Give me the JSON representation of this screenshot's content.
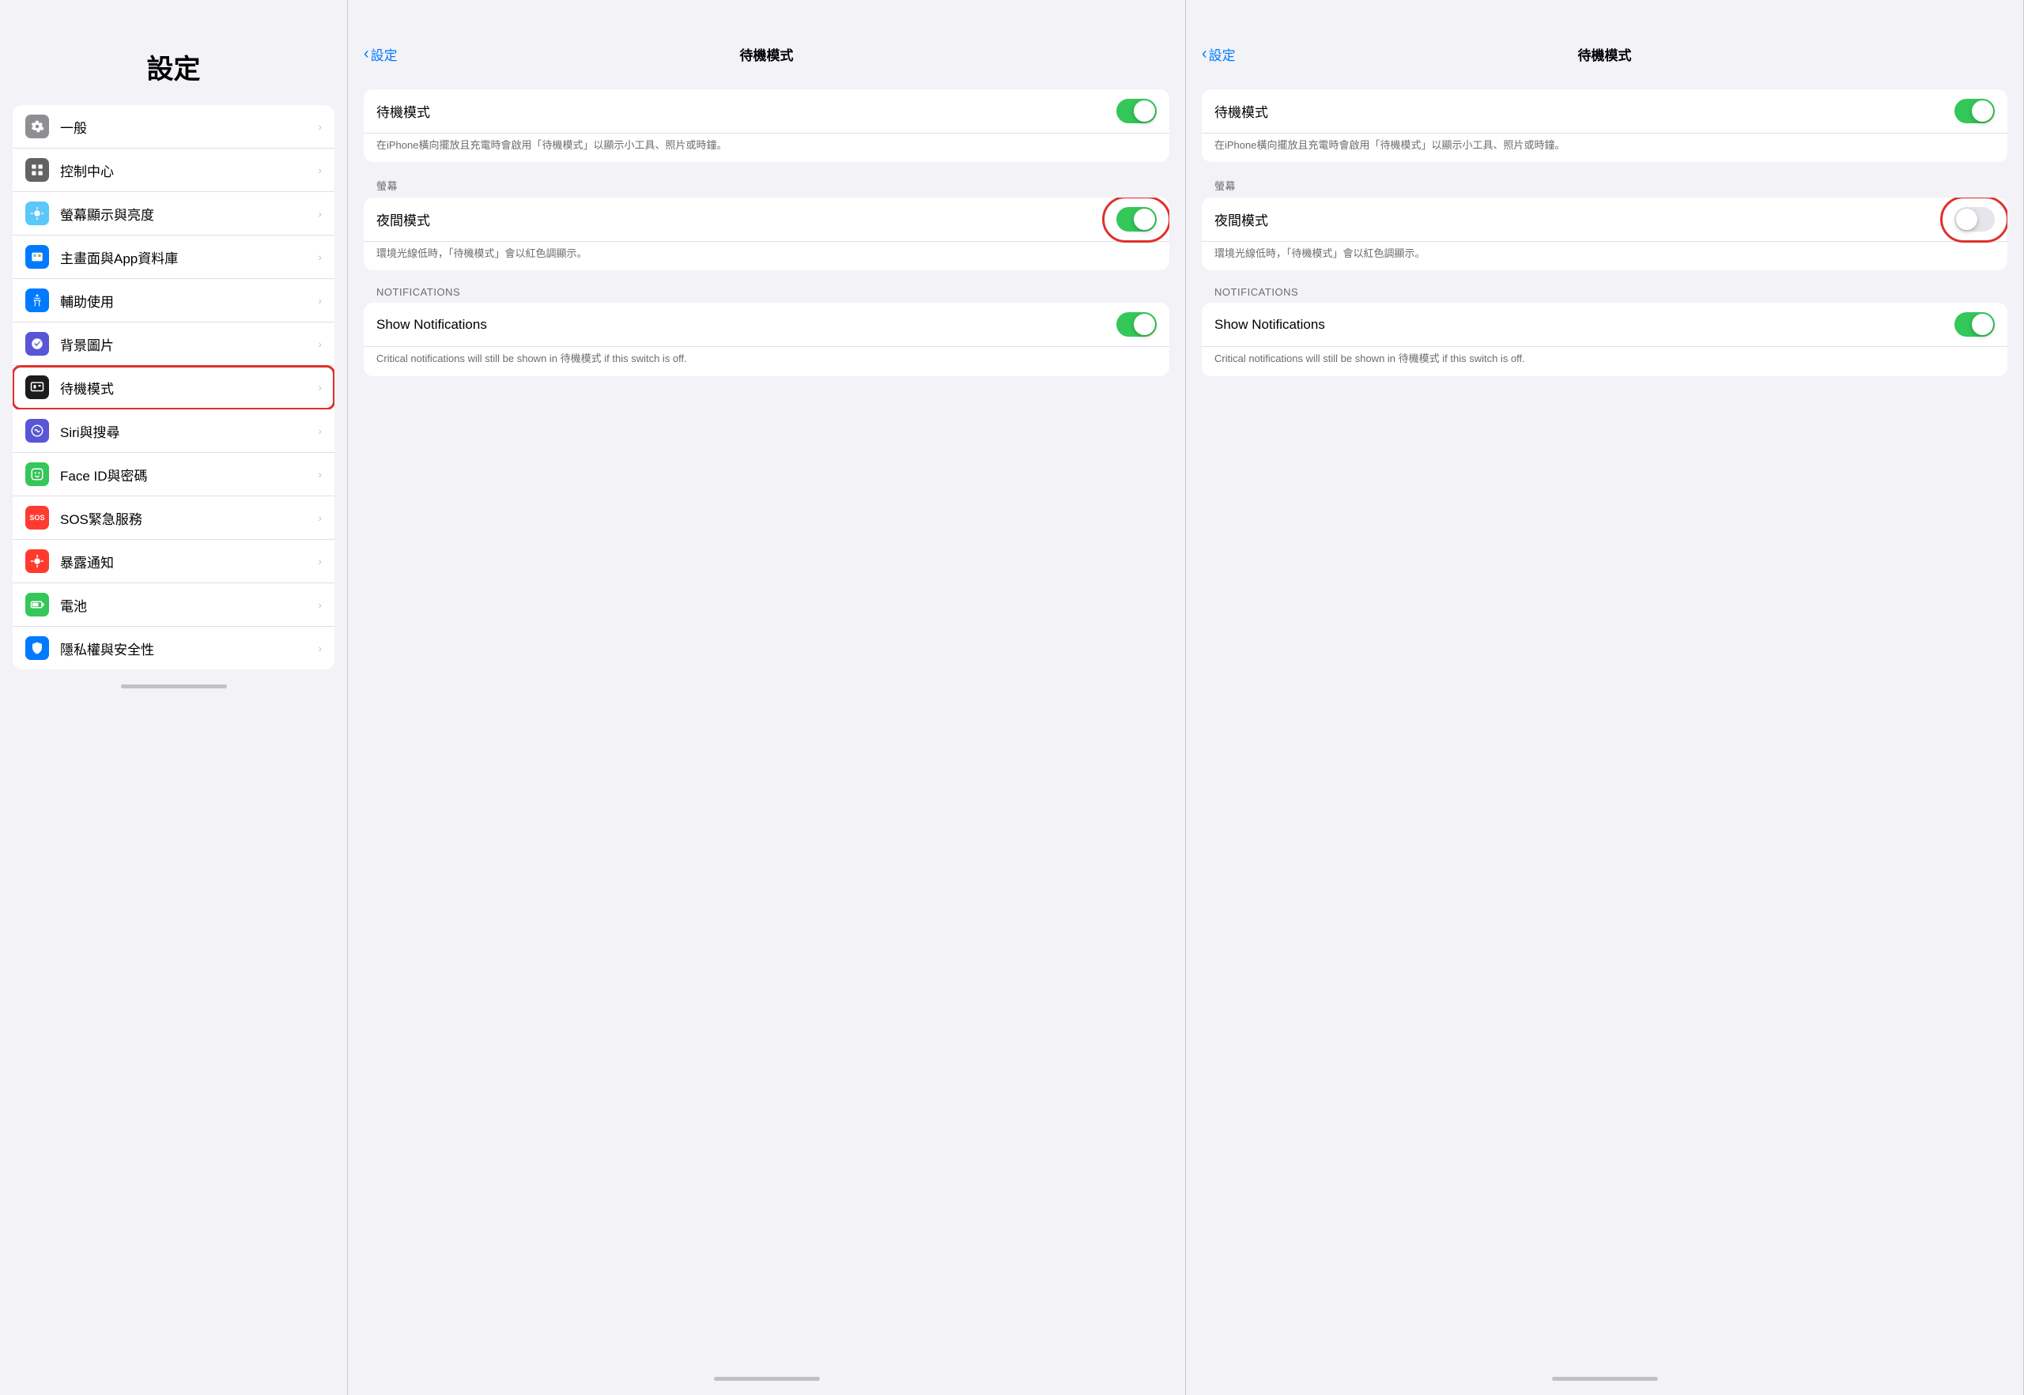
{
  "left": {
    "title": "設定",
    "items": [
      {
        "id": "general",
        "label": "一般",
        "iconClass": "ic-gray",
        "icon": "⚙️"
      },
      {
        "id": "control-center",
        "label": "控制中心",
        "iconClass": "ic-gray2",
        "icon": "🎛"
      },
      {
        "id": "display",
        "label": "螢幕顯示與亮度",
        "iconClass": "ic-blue2",
        "icon": "☀️"
      },
      {
        "id": "homescreen",
        "label": "主畫面與App資料庫",
        "iconClass": "ic-blue",
        "icon": "📱"
      },
      {
        "id": "accessibility",
        "label": "輔助使用",
        "iconClass": "ic-blue",
        "icon": "♿"
      },
      {
        "id": "wallpaper",
        "label": "背景圖片",
        "iconClass": "ic-indigo",
        "icon": "🌸"
      },
      {
        "id": "standby",
        "label": "待機模式",
        "iconClass": "ic-dark",
        "icon": "⊞",
        "highlighted": true
      },
      {
        "id": "siri",
        "label": "Siri與搜尋",
        "iconClass": "ic-indigo",
        "icon": "◉"
      },
      {
        "id": "faceid",
        "label": "Face ID與密碼",
        "iconClass": "ic-green",
        "icon": "😊"
      },
      {
        "id": "sos",
        "label": "SOS緊急服務",
        "iconClass": "ic-sos",
        "icon": "SOS"
      },
      {
        "id": "exposure",
        "label": "暴露通知",
        "iconClass": "ic-red",
        "icon": "☀"
      },
      {
        "id": "battery",
        "label": "電池",
        "iconClass": "ic-green",
        "icon": "🔋"
      },
      {
        "id": "privacy",
        "label": "隱私權與安全性",
        "iconClass": "ic-blue",
        "icon": "🤚"
      }
    ]
  },
  "detail_left": {
    "back_label": "設定",
    "title": "待機模式",
    "standby_label": "待機模式",
    "standby_on": true,
    "standby_desc": "在iPhone橫向擺放且充電時會啟用「待機模式」以顯示小工具、照片或時鐘。",
    "screen_section": "螢幕",
    "night_mode_label": "夜間模式",
    "night_mode_on": true,
    "night_mode_desc": "環境光線低時，「待機模式」會以紅色調顯示。",
    "notifications_section": "NOTIFICATIONS",
    "show_notifications_label": "Show Notifications",
    "show_notifications_on": true,
    "notifications_desc": "Critical notifications will still be shown in 待機模式 if this switch is off."
  },
  "detail_right": {
    "back_label": "設定",
    "title": "待機模式",
    "standby_label": "待機模式",
    "standby_on": true,
    "standby_desc": "在iPhone橫向擺放且充電時會啟用「待機模式」以顯示小工具、照片或時鐘。",
    "screen_section": "螢幕",
    "night_mode_label": "夜間模式",
    "night_mode_on": false,
    "night_mode_desc": "環境光線低時，「待機模式」會以紅色調顯示。",
    "notifications_section": "NOTIFICATIONS",
    "show_notifications_label": "Show Notifications",
    "show_notifications_on": true,
    "notifications_desc": "Critical notifications will still be shown in 待機模式 if this switch is off."
  }
}
